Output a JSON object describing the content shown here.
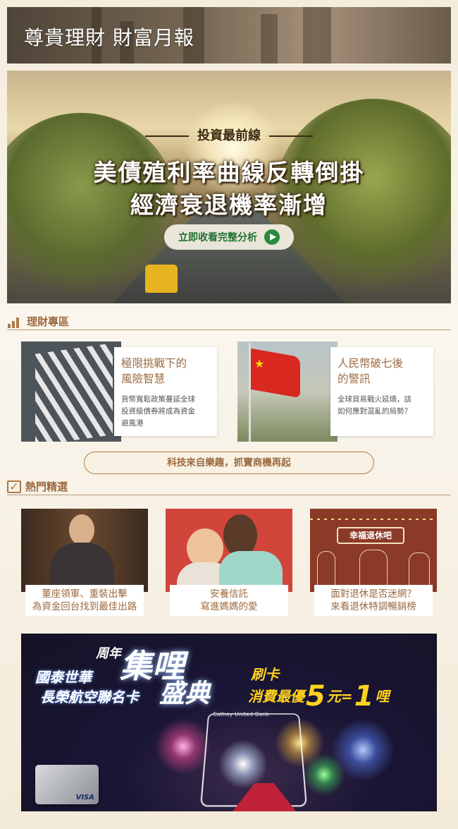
{
  "header": {
    "title": "尊貴理財 財富月報"
  },
  "hero": {
    "kicker": "投資最前線",
    "headline_line1": "美債殖利率曲線反轉倒掛",
    "headline_line2": "經濟衰退機率漸增",
    "cta_label": "立即收看完整分析"
  },
  "finance_zone": {
    "title": "理財專區",
    "cards": [
      {
        "title": "極限挑戰下的風險智慧",
        "title_l1": "極限挑戰下的",
        "title_l2": "風險智慧",
        "desc": "貨幣寬鬆政策蔓延全球投資級債券將成為資金避風港",
        "desc_l1": "貨幣寬鬆政策蔓延全球",
        "desc_l2": "投資級債券將成為資金",
        "desc_l3": "避風港"
      },
      {
        "title": "人民幣破七後的警訊",
        "title_l1": "人民幣破七後",
        "title_l2": "的警訊",
        "desc": "全球貿易戰火延燒，該如何應對混亂的局勢？",
        "desc_l1": "全球貿易戰火延燒，該",
        "desc_l2": "如何應對混亂的局勢？"
      }
    ],
    "banner_text": "科技來自樂趣，抓寶商機再起"
  },
  "hot_picks": {
    "title": "熱門精選",
    "items": [
      {
        "line1": "董座領軍、重裝出擊",
        "line2": "為資金回台找到最佳出路"
      },
      {
        "line1": "安養信託",
        "line2": "寫進媽媽的愛"
      },
      {
        "line1": "面對退休是否迷網？",
        "line2": "來看退休特調暢銷榜",
        "sign": "幸福退休吧"
      }
    ]
  },
  "promo": {
    "brand_line1": "國泰世華",
    "brand_line2": "長榮航空聯名卡",
    "anniv": "周年",
    "big1": "集哩",
    "big2": "盛典",
    "swipe": "刷卡",
    "offer_prefix": "消費最優",
    "n1": "5",
    "unit1": "元",
    "eq": "=",
    "n2": "1",
    "unit2": "哩",
    "card_brand": "VISA",
    "frame_brand": "Cathay United Bank"
  },
  "colors": {
    "accent": "#9c6a40",
    "cta_green": "#2b8a3e",
    "promo_yellow": "#ffd21e"
  }
}
